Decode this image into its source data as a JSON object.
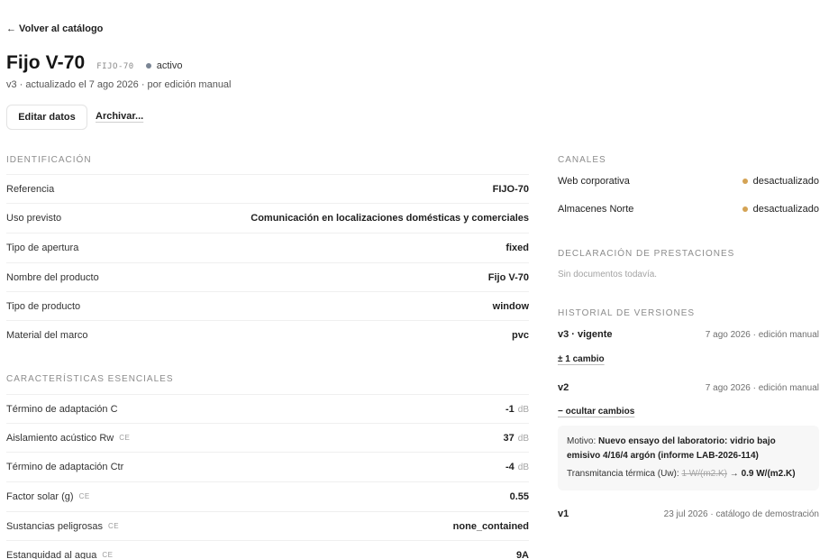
{
  "nav": {
    "back_label": "← Volver al catálogo"
  },
  "header": {
    "title": "Fijo V-70",
    "code": "FIJO-70",
    "status": "activo",
    "subtitle": "v3 · actualizado el 7 ago 2026 · por edición manual"
  },
  "actions": {
    "edit_label": "Editar datos",
    "archive_label": "Archivar..."
  },
  "identification": {
    "title": "IDENTIFICACIÓN",
    "rows": [
      {
        "label": "Referencia",
        "value": "FIJO-70"
      },
      {
        "label": "Uso previsto",
        "value": "Comunicación en localizaciones domésticas y comerciales"
      },
      {
        "label": "Tipo de apertura",
        "value": "fixed"
      },
      {
        "label": "Nombre del producto",
        "value": "Fijo V-70"
      },
      {
        "label": "Tipo de producto",
        "value": "window"
      },
      {
        "label": "Material del marco",
        "value": "pvc"
      }
    ]
  },
  "characteristics": {
    "title": "CARACTERÍSTICAS ESENCIALES",
    "ce_tag": "CE",
    "rows": [
      {
        "label": "Término de adaptación C",
        "value": "-1",
        "unit": "dB"
      },
      {
        "label": "Aislamiento acústico Rw",
        "value": "37",
        "unit": "dB"
      },
      {
        "label": "Término de adaptación Ctr",
        "value": "-4",
        "unit": "dB"
      },
      {
        "label": "Factor solar (g)",
        "value": "0.55",
        "unit": ""
      },
      {
        "label": "Sustancias peligrosas",
        "value": "none_contained",
        "unit": ""
      },
      {
        "label": "Estanquidad al agua",
        "value": "9A",
        "unit": ""
      }
    ]
  },
  "channels": {
    "title": "CANALES",
    "rows": [
      {
        "label": "Web corporativa",
        "status": "desactualizado"
      },
      {
        "label": "Almacenes Norte",
        "status": "desactualizado"
      }
    ]
  },
  "declaration": {
    "title": "DECLARACIÓN DE PRESTACIONES",
    "empty_text": "Sin documentos todavía."
  },
  "history": {
    "title": "HISTORIAL DE VERSIONES",
    "v3": {
      "label": "v3 · vigente",
      "meta": "7 ago 2026 · edición manual",
      "toggle": "± 1 cambio"
    },
    "v2": {
      "label": "v2",
      "meta": "7 ago 2026 · edición manual",
      "toggle": "− ocultar cambios",
      "reason_label": "Motivo:",
      "reason_text": "Nuevo ensayo del laboratorio: vidrio bajo emisivo 4/16/4 argón (informe LAB-2026-114)",
      "change_label": "Transmitancia térmica (Uw):",
      "old_value": "1 W/(m2.K)",
      "arrow": "→",
      "new_value": "0.9 W/(m2.K)"
    },
    "v1": {
      "label": "v1",
      "meta": "23 jul 2026 · catálogo de demostración"
    }
  },
  "colors": {
    "status_active": "#7a8594",
    "status_outdated": "#d4a354"
  }
}
